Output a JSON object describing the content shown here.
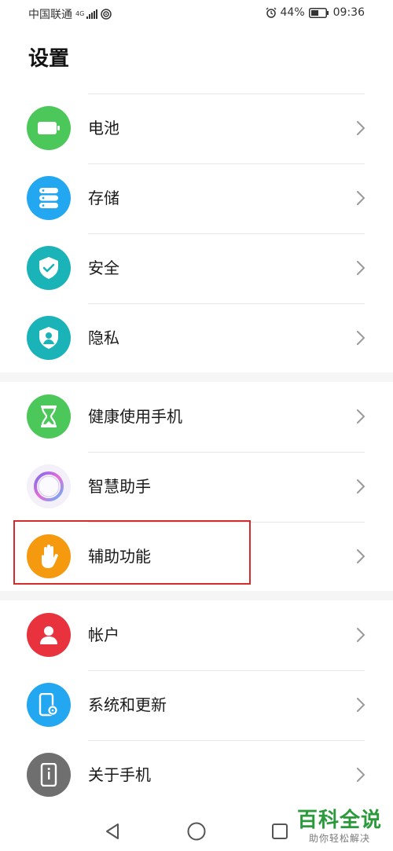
{
  "status_bar": {
    "carrier": "中国联通",
    "network_type": "4G",
    "network_sub": "46",
    "battery_percent": "44%",
    "time": "09:36"
  },
  "page": {
    "title": "设置"
  },
  "settings": {
    "battery": {
      "label": "电池",
      "color": "#4cc75a"
    },
    "storage": {
      "label": "存储",
      "color": "#22a7f0"
    },
    "security": {
      "label": "安全",
      "color": "#19b3b8"
    },
    "privacy": {
      "label": "隐私",
      "color": "#19b3b8"
    },
    "digital_balance": {
      "label": "健康使用手机",
      "color": "#4cc75a"
    },
    "assistant": {
      "label": "智慧助手"
    },
    "accessibility": {
      "label": "辅助功能",
      "color": "#f59a0f"
    },
    "account": {
      "label": "帐户",
      "color": "#e8333f"
    },
    "system_update": {
      "label": "系统和更新",
      "color": "#22a7f0"
    },
    "about_phone": {
      "label": "关于手机",
      "color": "#6f6f6f"
    }
  },
  "watermark": {
    "title": "百科全说",
    "subtitle": "助你轻松解决"
  }
}
